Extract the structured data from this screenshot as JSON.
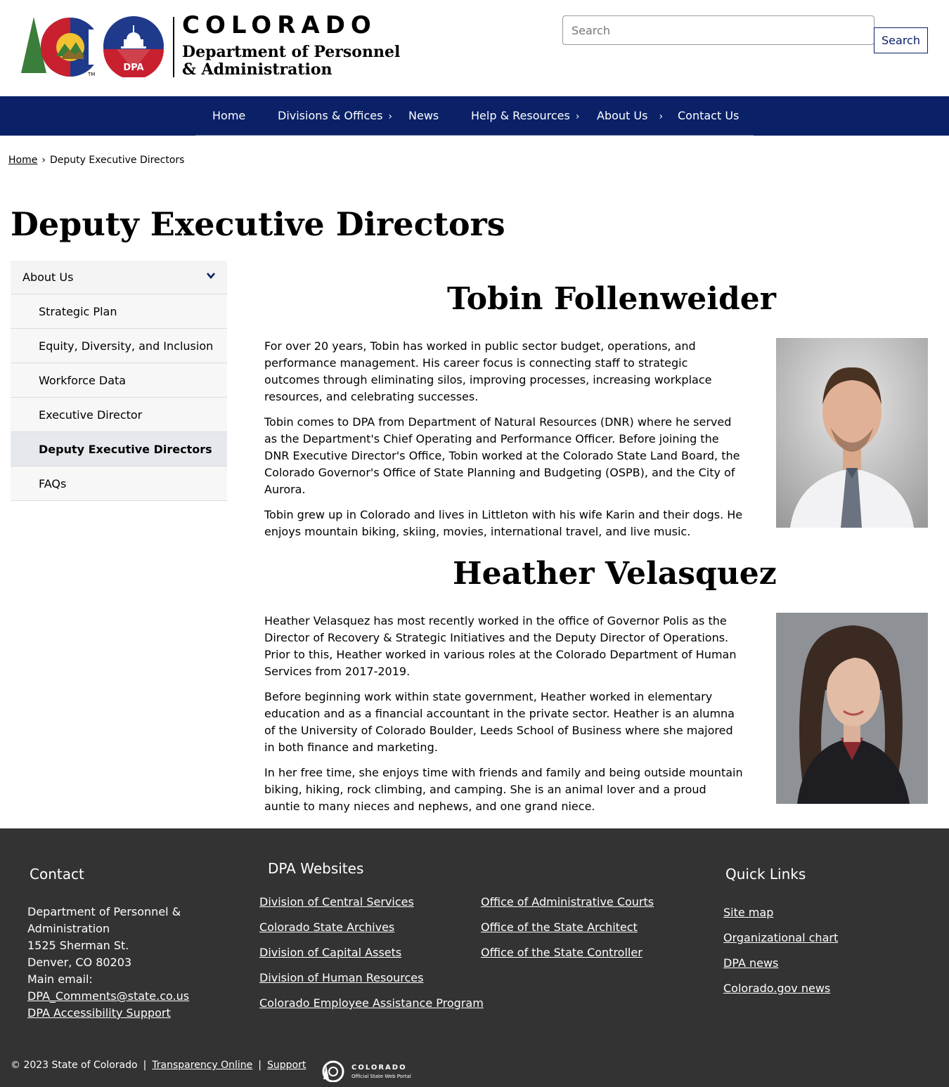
{
  "header": {
    "logo_state": "COLORADO",
    "logo_dept_line1": "Department of Personnel",
    "logo_dept_line2": "& Administration",
    "logo_badge": "DPA",
    "search_placeholder": "Search",
    "search_button": "Search"
  },
  "nav": {
    "items": [
      {
        "label": "Home",
        "has_submenu": false
      },
      {
        "label": "Divisions & Offices",
        "has_submenu": true
      },
      {
        "label": "News",
        "has_submenu": false
      },
      {
        "label": "Help & Resources",
        "has_submenu": true
      },
      {
        "label": "About Us",
        "has_submenu": true
      },
      {
        "label": "Contact Us",
        "has_submenu": false
      }
    ],
    "chevron": "›"
  },
  "breadcrumb": {
    "home": "Home",
    "separator": "›",
    "current": "Deputy Executive Directors"
  },
  "page_title": "Deputy Executive Directors",
  "sidebar": {
    "heading": "About Us",
    "items": [
      {
        "label": "Strategic Plan",
        "active": false
      },
      {
        "label": "Equity, Diversity, and Inclusion",
        "active": false
      },
      {
        "label": "Workforce Data",
        "active": false
      },
      {
        "label": "Executive Director",
        "active": false
      },
      {
        "label": "Deputy Executive Directors",
        "active": true
      },
      {
        "label": "FAQs",
        "active": false
      }
    ]
  },
  "bios": [
    {
      "name": "Tobin Follenweider",
      "paragraphs": [
        "For over 20 years, Tobin has worked in public sector budget, operations, and performance management. His career focus is connecting staff to strategic outcomes through eliminating silos, improving processes, increasing workplace resources, and celebrating successes.",
        "Tobin comes to DPA from Department of Natural Resources (DNR) where he served as the Department's Chief Operating and Performance Officer. Before joining the DNR Executive Director's Office, Tobin worked at the Colorado State Land Board, the Colorado Governor's Office of State Planning and Budgeting (OSPB), and the City of Aurora.",
        "Tobin grew up in Colorado and lives in Littleton with his wife Karin and their dogs. He enjoys mountain biking, skiing, movies, international travel, and live music."
      ]
    },
    {
      "name": "Heather Velasquez",
      "paragraphs": [
        "Heather Velasquez has most recently worked in the office of Governor Polis as the Director of Recovery & Strategic Initiatives and the Deputy Director of Operations. Prior to this, Heather worked in various roles at the Colorado Department of Human Services from 2017-2019.",
        "Before beginning work within state government, Heather worked in elementary education and as a financial accountant in the private sector. Heather is an alumna of the University of Colorado Boulder, Leeds School of Business where she majored in both finance and marketing.",
        "In her free time, she enjoys time with friends and family and being outside mountain biking, hiking, rock climbing, and camping. She is an animal lover and a proud auntie to many nieces and nephews, and one grand niece."
      ]
    }
  ],
  "footer": {
    "contact": {
      "heading": "Contact",
      "address_line1": "Department of Personnel &",
      "address_line2": "Administration",
      "street": "1525 Sherman St.",
      "city": "Denver, CO 80203",
      "email_label": "Main email:",
      "email": "DPA_Comments@state.co.us",
      "accessibility": "DPA Accessibility Support"
    },
    "websites": {
      "heading": "DPA Websites",
      "col1": [
        "Division of Central Services",
        "Colorado State Archives",
        "Division of Capital Assets",
        "Division of Human Resources",
        "Colorado Employee Assistance Program"
      ],
      "col2": [
        "Office of Administrative Courts",
        "Office of the State Architect",
        "Office of the State Controller"
      ]
    },
    "quick_links": {
      "heading": "Quick Links",
      "items": [
        "Site map",
        "Organizational chart",
        "DPA news",
        "Colorado.gov news"
      ]
    },
    "bottom": {
      "copyright": "© 2023 State of Colorado",
      "separator": "|",
      "transparency": "Transparency Online",
      "support": "Support",
      "portal_name": "COLORADO",
      "portal_sub": "Official State Web Portal"
    }
  },
  "colors": {
    "nav_bg": "#0a2168",
    "footer_bg": "#333333",
    "logo_red": "#c8202f",
    "logo_blue": "#1f3a8a",
    "logo_gold": "#f2c230",
    "logo_green": "#3b7d3a"
  }
}
